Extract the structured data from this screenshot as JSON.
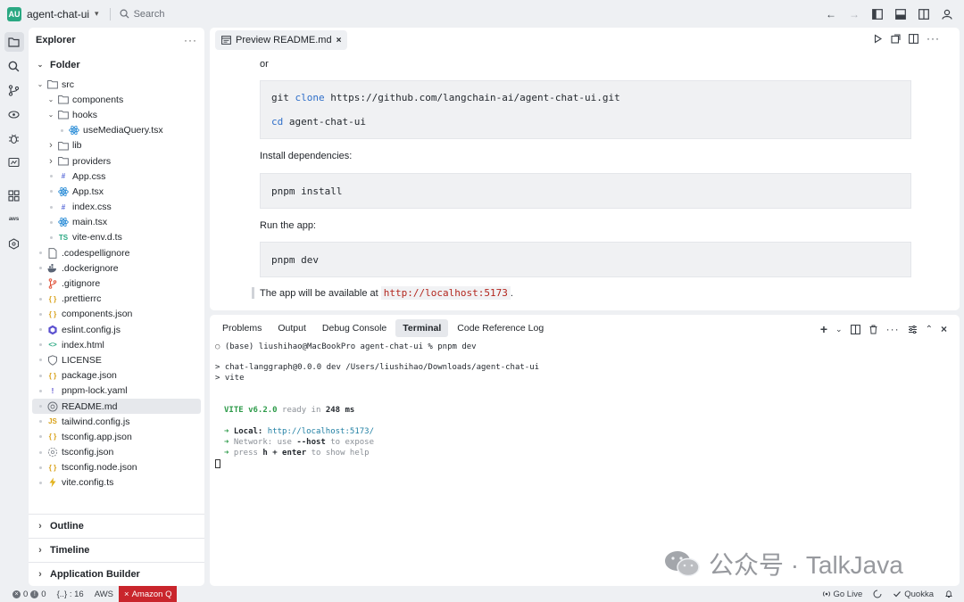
{
  "titlebar": {
    "project_badge": "AU",
    "project_name": "agent-chat-ui",
    "search_placeholder": "Search"
  },
  "activity": {
    "aws_label": "aws"
  },
  "explorer": {
    "title": "Explorer",
    "folder_section": "Folder",
    "tree": [
      {
        "depth": 0,
        "kind": "folder-open",
        "name": "src"
      },
      {
        "depth": 1,
        "kind": "folder-open",
        "name": "components"
      },
      {
        "depth": 1,
        "kind": "folder-open",
        "name": "hooks"
      },
      {
        "depth": 2,
        "kind": "react",
        "name": "useMediaQuery.tsx"
      },
      {
        "depth": 1,
        "kind": "folder-closed",
        "name": "lib"
      },
      {
        "depth": 1,
        "kind": "folder-closed",
        "name": "providers"
      },
      {
        "depth": 1,
        "kind": "css",
        "name": "App.css"
      },
      {
        "depth": 1,
        "kind": "react",
        "name": "App.tsx"
      },
      {
        "depth": 1,
        "kind": "css",
        "name": "index.css"
      },
      {
        "depth": 1,
        "kind": "react",
        "name": "main.tsx"
      },
      {
        "depth": 1,
        "kind": "ts",
        "name": "vite-env.d.ts"
      },
      {
        "depth": 0,
        "kind": "file",
        "name": ".codespellignore"
      },
      {
        "depth": 0,
        "kind": "docker",
        "name": ".dockerignore"
      },
      {
        "depth": 0,
        "kind": "git",
        "name": ".gitignore"
      },
      {
        "depth": 0,
        "kind": "json",
        "name": ".prettierrc"
      },
      {
        "depth": 0,
        "kind": "json",
        "name": "components.json"
      },
      {
        "depth": 0,
        "kind": "eslint",
        "name": "eslint.config.js"
      },
      {
        "depth": 0,
        "kind": "html",
        "name": "index.html"
      },
      {
        "depth": 0,
        "kind": "license",
        "name": "LICENSE"
      },
      {
        "depth": 0,
        "kind": "json",
        "name": "package.json"
      },
      {
        "depth": 0,
        "kind": "yaml",
        "name": "pnpm-lock.yaml"
      },
      {
        "depth": 0,
        "kind": "readme",
        "name": "README.md",
        "selected": true
      },
      {
        "depth": 0,
        "kind": "js",
        "name": "tailwind.config.js"
      },
      {
        "depth": 0,
        "kind": "json",
        "name": "tsconfig.app.json"
      },
      {
        "depth": 0,
        "kind": "tsconfig",
        "name": "tsconfig.json"
      },
      {
        "depth": 0,
        "kind": "json",
        "name": "tsconfig.node.json"
      },
      {
        "depth": 0,
        "kind": "vite",
        "name": "vite.config.ts"
      }
    ],
    "bottom_sections": [
      "Outline",
      "Timeline",
      "Application Builder"
    ]
  },
  "editor": {
    "tab_label": "Preview README.md",
    "or_text": "or",
    "clone_cmd": "git",
    "clone_kw": "clone",
    "clone_url": "https://github.com/langchain-ai/agent-chat-ui.git",
    "cd_kw": "cd",
    "cd_arg": "agent-chat-ui",
    "install_heading": "Install dependencies:",
    "install_cmd": "pnpm install",
    "run_heading": "Run the app:",
    "run_cmd": "pnpm dev",
    "available_prefix": "The app will be available at",
    "available_url": "http://localhost:5173",
    "available_suffix": "."
  },
  "panel": {
    "tabs": [
      "Problems",
      "Output",
      "Debug Console",
      "Terminal",
      "Code Reference Log"
    ],
    "active_tab": "Terminal",
    "terminal": {
      "prompt_line": "(base) liushihao@MacBookPro agent-chat-ui % pnpm dev",
      "script_line1": "> chat-langgraph@0.0.0 dev /Users/liushihao/Downloads/agent-chat-ui",
      "script_line2": "> vite",
      "vite_label": "VITE v6.2.0",
      "ready_text": "ready in",
      "ready_ms": "248 ms",
      "local_label": "Local:",
      "local_url": "http://localhost:5173/",
      "network_label": "Network:",
      "network_text": "use",
      "network_flag": "--host",
      "network_suffix": "to expose",
      "press_text": "press",
      "press_keys": "h + enter",
      "press_suffix": "to show help",
      "arrow": "➜"
    }
  },
  "watermark": {
    "text": "公众号 · TalkJava"
  },
  "statusbar": {
    "errors": "0",
    "warnings": "0",
    "braces": "{..} : 16",
    "aws": "AWS",
    "amazon_q": "Amazon Q",
    "go_live": "Go Live",
    "quokka": "Quokka"
  },
  "colors": {
    "accent_green": "#2aa882",
    "amazon_q_red": "#c9252c",
    "link_blue": "#2f6fc9"
  }
}
